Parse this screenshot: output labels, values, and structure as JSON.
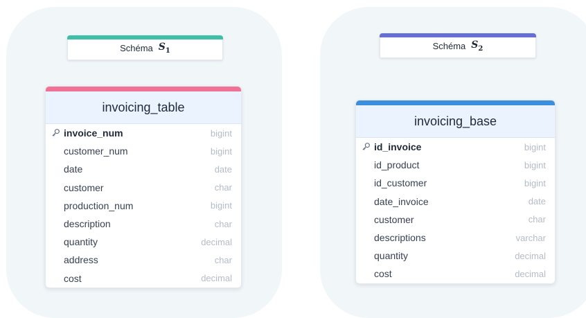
{
  "colors": {
    "panel_bg": "#f1f6f9",
    "schema1_accent": "#3fbfa7",
    "schema2_accent": "#6670d0",
    "table1_accent": "#f07096",
    "table2_accent": "#3b8fdc"
  },
  "schemas": [
    {
      "label": "Schéma",
      "math_var": "S",
      "math_sub": "1",
      "table": {
        "name": "invoicing_table",
        "columns": [
          {
            "name": "invoice_num",
            "type": "bigint",
            "primary_key": true
          },
          {
            "name": "customer_num",
            "type": "bigint"
          },
          {
            "name": "date",
            "type": "date"
          },
          {
            "name": "customer",
            "type": "char"
          },
          {
            "name": "production_num",
            "type": "bigint"
          },
          {
            "name": "description",
            "type": "char"
          },
          {
            "name": "quantity",
            "type": "decimal"
          },
          {
            "name": "address",
            "type": "char"
          },
          {
            "name": "cost",
            "type": "decimal"
          }
        ]
      }
    },
    {
      "label": "Schéma",
      "math_var": "S",
      "math_sub": "2",
      "table": {
        "name": "invoicing_base",
        "columns": [
          {
            "name": "id_invoice",
            "type": "bigint",
            "primary_key": true
          },
          {
            "name": "id_product",
            "type": "bigint"
          },
          {
            "name": "id_customer",
            "type": "bigint"
          },
          {
            "name": "date_invoice",
            "type": "date"
          },
          {
            "name": "customer",
            "type": "char"
          },
          {
            "name": "descriptions",
            "type": "varchar"
          },
          {
            "name": "quantity",
            "type": "decimal"
          },
          {
            "name": "cost",
            "type": "decimal"
          }
        ]
      }
    }
  ]
}
